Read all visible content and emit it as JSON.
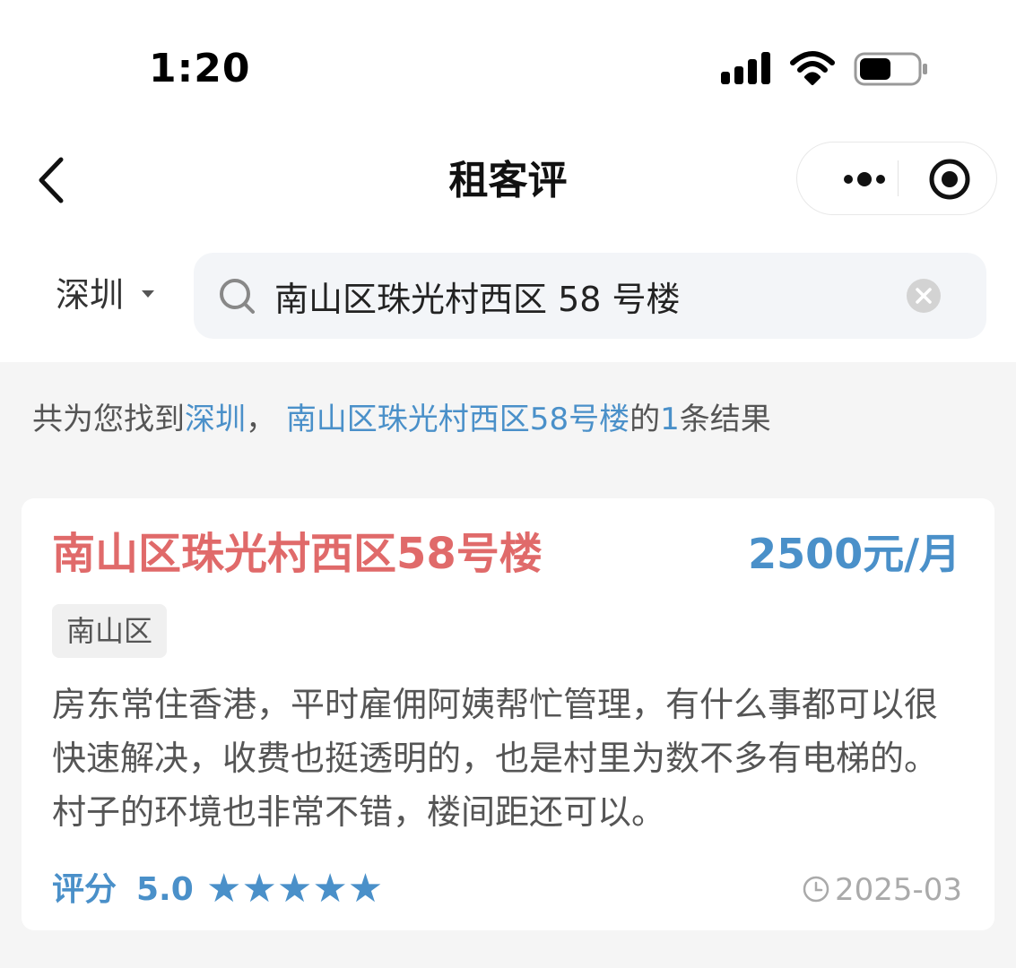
{
  "status_bar": {
    "time": "1:20"
  },
  "nav": {
    "title": "租客评"
  },
  "search": {
    "city": "深圳",
    "query": "南山区珠光村西区 58 号楼"
  },
  "results_summary": {
    "prefix": "共为您找到",
    "city": "深圳",
    "separator": "，",
    "keyword": "南山区珠光村西区58号楼",
    "mid": "的",
    "count": "1",
    "suffix": "条结果"
  },
  "results": [
    {
      "name": "南山区珠光村西区58号楼",
      "price": "2500元/月",
      "district_tag": "南山区",
      "review": "房东常住香港，平时雇佣阿姨帮忙管理，有什么事都可以很快速解决，收费也挺透明的，也是村里为数不多有电梯的。村子的环境也非常不错，楼间距还可以。",
      "score_label": "评分",
      "score": "5.0",
      "stars": "★★★★★",
      "date": "2025-03"
    }
  ],
  "colors": {
    "accent": "#4a90c9",
    "title_red": "#e06a6a"
  }
}
